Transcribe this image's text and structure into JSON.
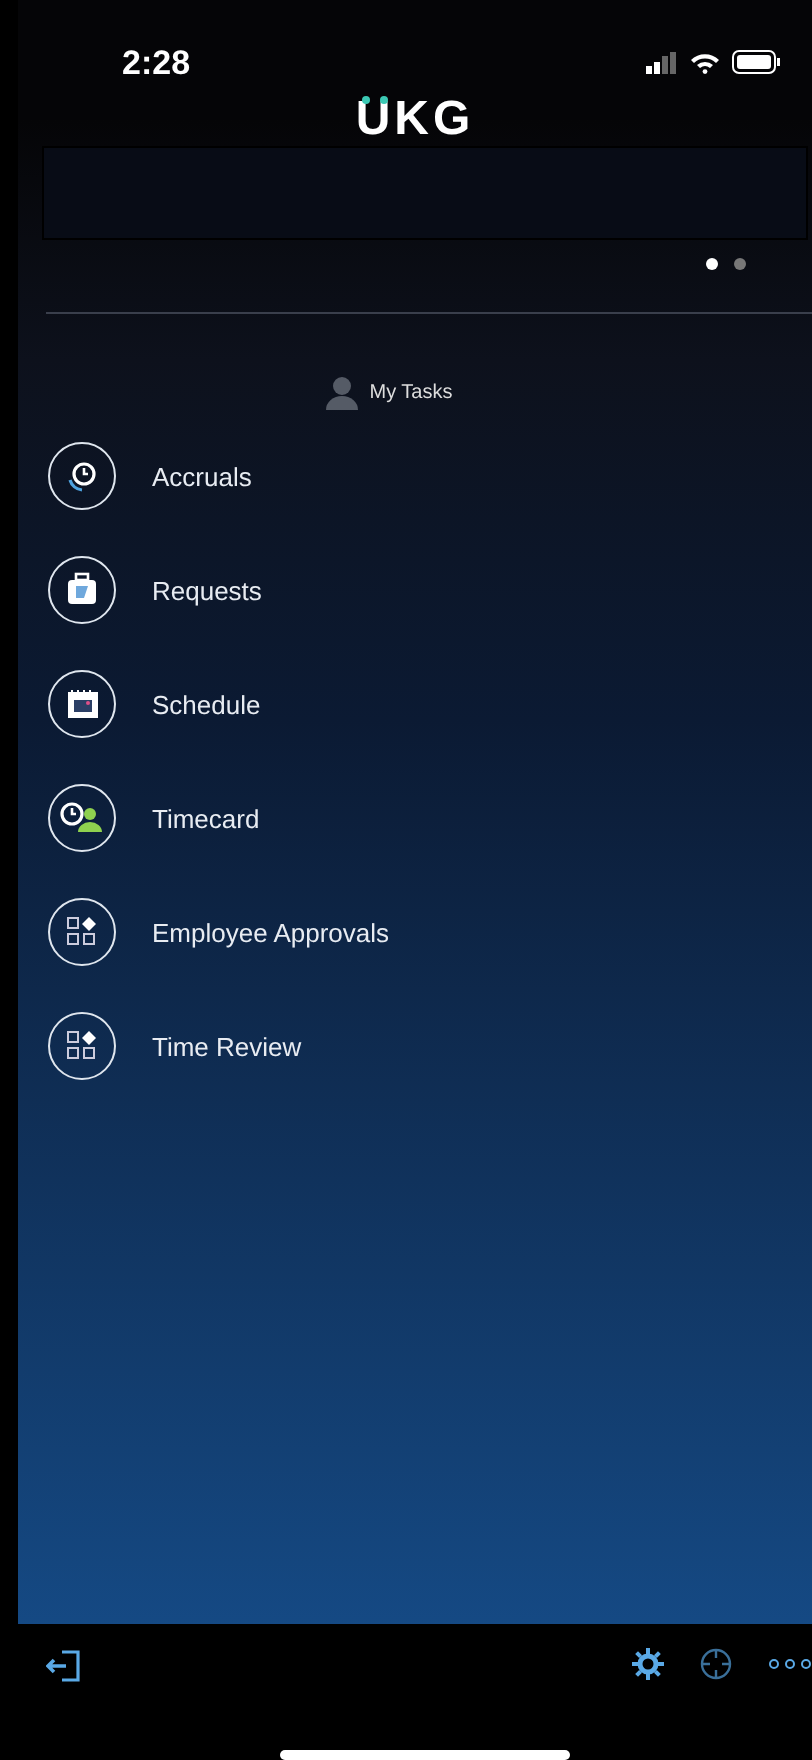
{
  "status_bar": {
    "time": "2:28"
  },
  "logo": "UKG",
  "carousel": {
    "pages": [
      {
        "selected": true
      },
      {
        "selected": false
      }
    ]
  },
  "section_title": "My Tasks",
  "tasks": [
    {
      "label": "Accruals",
      "kind": "accruals"
    },
    {
      "label": "Requests",
      "kind": "requests"
    },
    {
      "label": "Schedule",
      "kind": "schedule"
    },
    {
      "label": "Timecard",
      "kind": "timecard"
    },
    {
      "label": "Employee Approvals",
      "kind": "approvals"
    },
    {
      "label": "Time Review",
      "kind": "approvals"
    }
  ]
}
